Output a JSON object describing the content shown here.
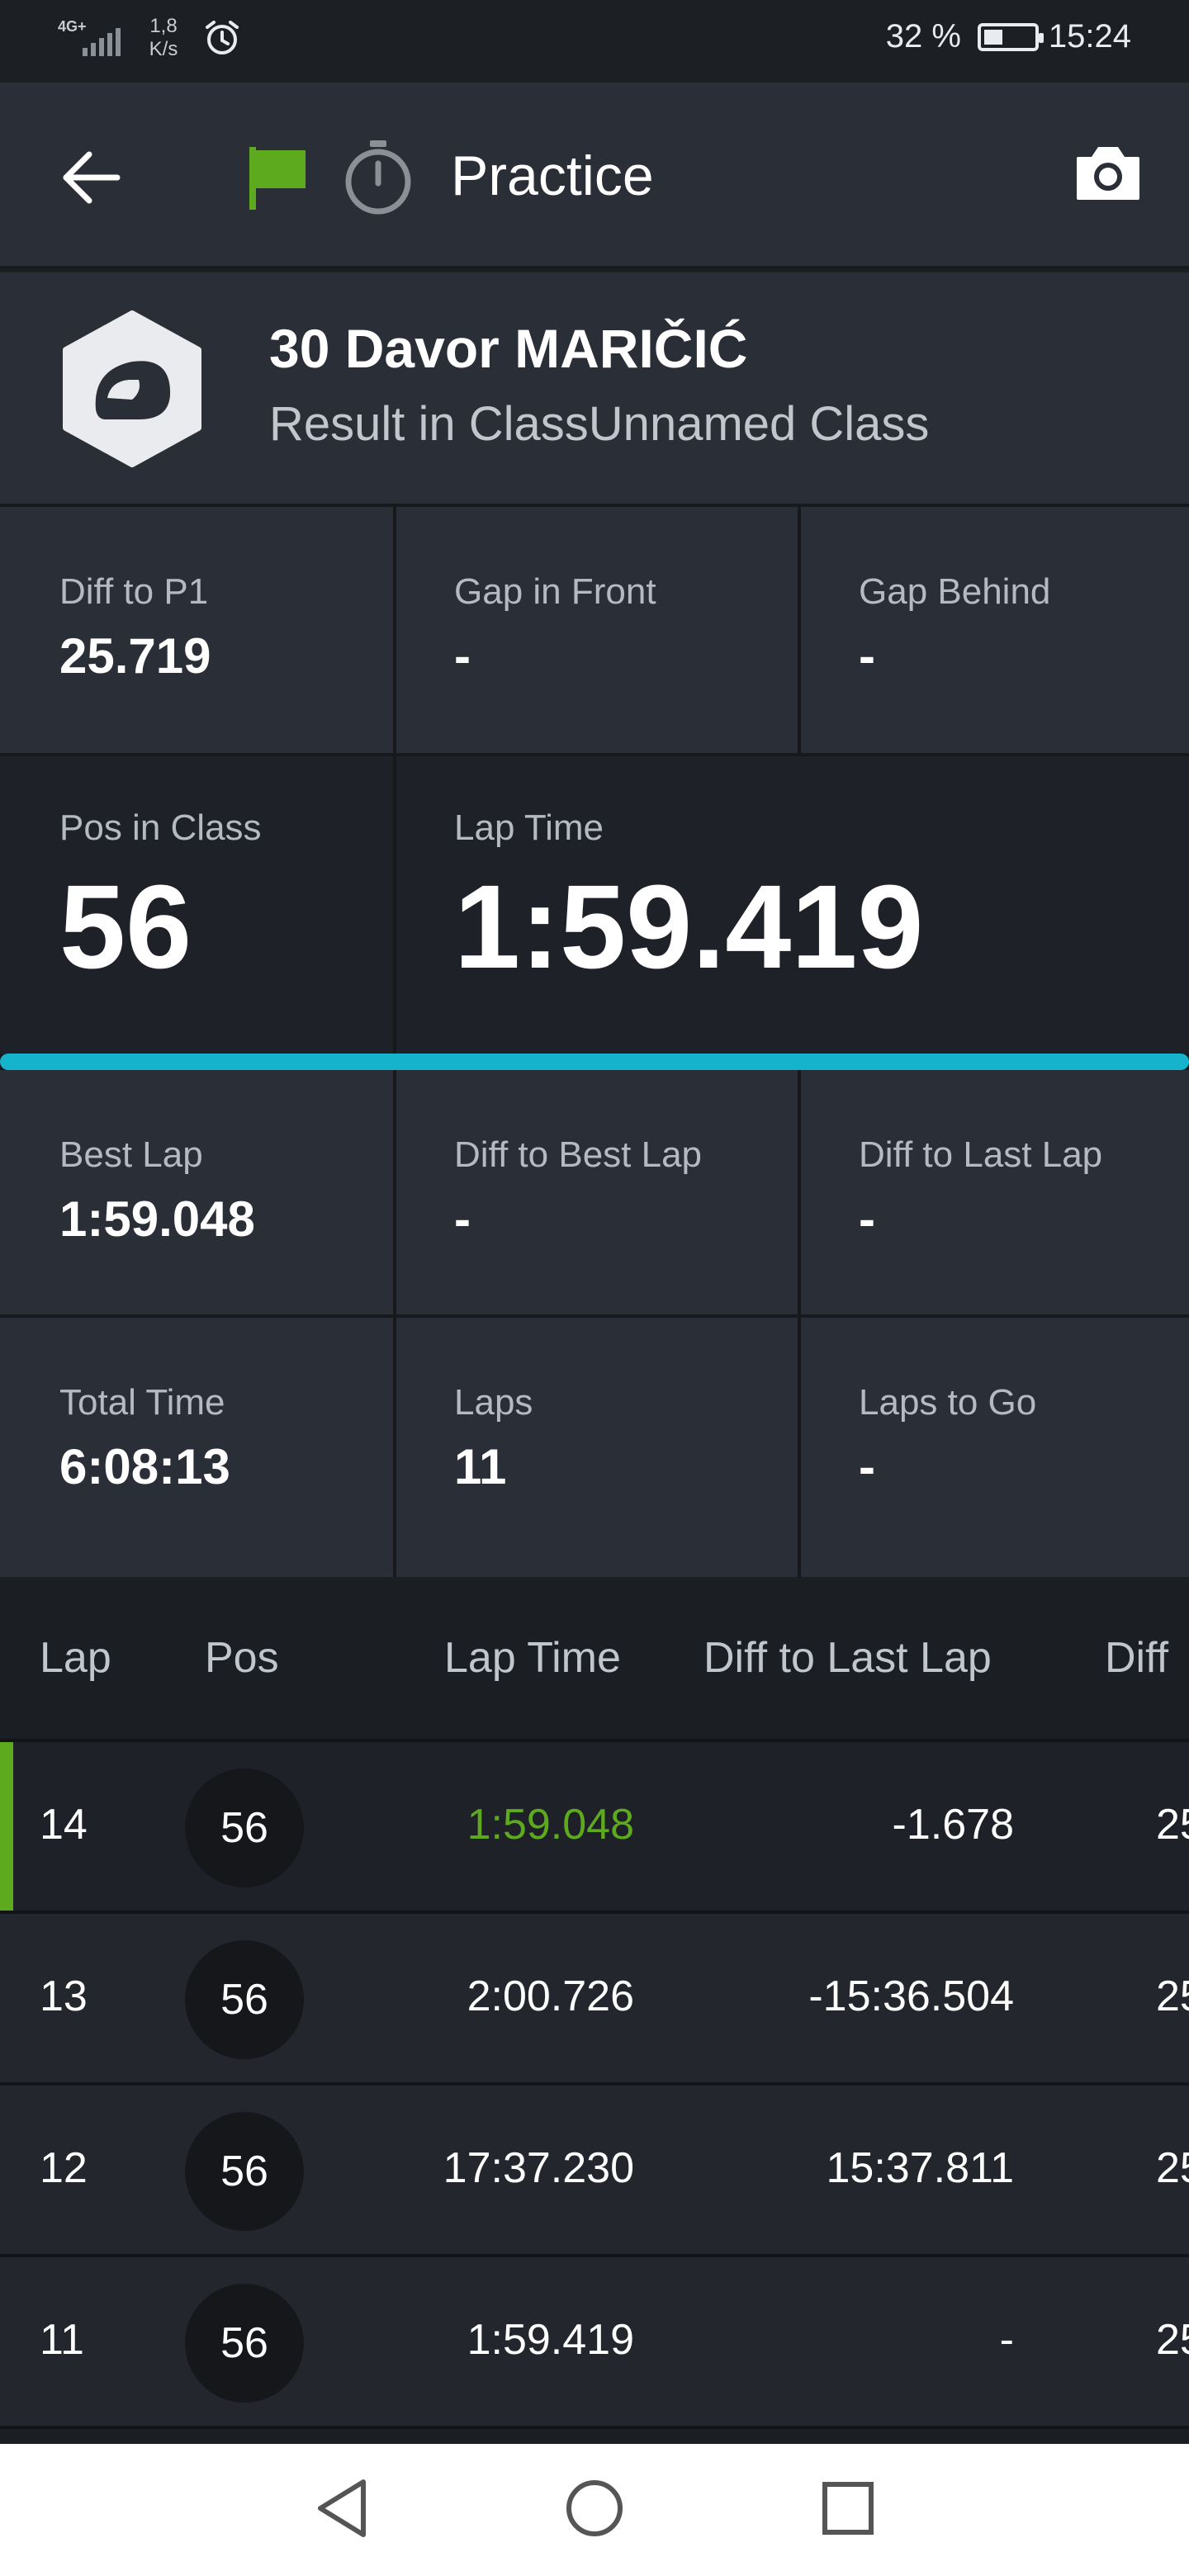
{
  "status_bar": {
    "network_type": "4G+",
    "net_speed_value": "1,8",
    "net_speed_unit": "K/s",
    "battery": "32 %",
    "time": "15:24"
  },
  "app_bar": {
    "title": "Practice",
    "flag_color": "#5eaa1e"
  },
  "rider": {
    "name": "30 Davor MARIČIĆ",
    "class_line": "Result in ClassUnnamed Class"
  },
  "stats_row1": [
    {
      "label": "Diff to P1",
      "value": "25.719"
    },
    {
      "label": "Gap in Front",
      "value": "-"
    },
    {
      "label": "Gap Behind",
      "value": "-"
    }
  ],
  "stats_big": [
    {
      "label": "Pos in Class",
      "value": "56"
    },
    {
      "label": "Lap Time",
      "value": "1:59.419"
    }
  ],
  "stats_row2": [
    {
      "label": "Best Lap",
      "value": "1:59.048"
    },
    {
      "label": "Diff to Best Lap",
      "value": "-"
    },
    {
      "label": "Diff to Last Lap",
      "value": "-"
    }
  ],
  "stats_row3": [
    {
      "label": "Total Time",
      "value": "6:08:13"
    },
    {
      "label": "Laps",
      "value": "11"
    },
    {
      "label": "Laps to Go",
      "value": "-"
    }
  ],
  "progress": {
    "fraction": 1.0,
    "color": "#16b4cc"
  },
  "table": {
    "headers": [
      "Lap",
      "Pos",
      "Lap Time",
      "Diff to Last Lap",
      "Diff"
    ],
    "rows": [
      {
        "lap": "14",
        "pos": "56",
        "lap_time": "1:59.048",
        "diff_last": "-1.678",
        "diff": "25"
      },
      {
        "lap": "13",
        "pos": "56",
        "lap_time": "2:00.726",
        "diff_last": "-15:36.504",
        "diff": "25"
      },
      {
        "lap": "12",
        "pos": "56",
        "lap_time": "17:37.230",
        "diff_last": "15:37.811",
        "diff": "25"
      },
      {
        "lap": "11",
        "pos": "56",
        "lap_time": "1:59.419",
        "diff_last": "-",
        "diff": "25"
      }
    ]
  },
  "nav_bar": {
    "back_icon": "triangle-back-icon",
    "home_icon": "circle-home-icon",
    "recents_icon": "square-recents-icon"
  }
}
